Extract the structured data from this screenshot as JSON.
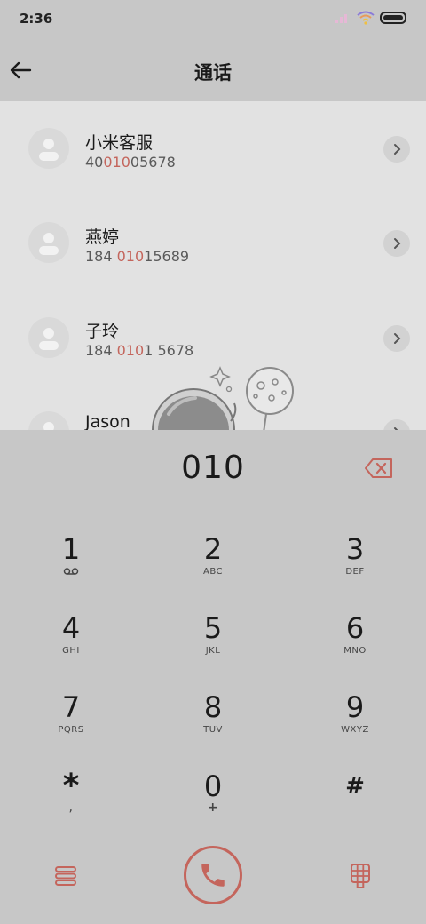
{
  "status": {
    "time": "2:36"
  },
  "header": {
    "title": "通话"
  },
  "contacts": [
    {
      "name": "小米客服",
      "num_pre": "40",
      "num_hl": "010",
      "num_post": "05678"
    },
    {
      "name": "燕婷",
      "num_pre": "184 ",
      "num_hl": "010",
      "num_post": "15689"
    },
    {
      "name": "子玲",
      "num_pre": "184 ",
      "num_hl": "010",
      "num_post": "1 5678"
    },
    {
      "name": "Jason",
      "num_pre": "",
      "num_hl": "",
      "num_post": ""
    }
  ],
  "dialer": {
    "input": "010",
    "keys": [
      {
        "digit": "1",
        "sub": ""
      },
      {
        "digit": "2",
        "sub": "ABC"
      },
      {
        "digit": "3",
        "sub": "DEF"
      },
      {
        "digit": "4",
        "sub": "GHI"
      },
      {
        "digit": "5",
        "sub": "JKL"
      },
      {
        "digit": "6",
        "sub": "MNO"
      },
      {
        "digit": "7",
        "sub": "PQRS"
      },
      {
        "digit": "8",
        "sub": "TUV"
      },
      {
        "digit": "9",
        "sub": "WXYZ"
      },
      {
        "digit": "*",
        "sub": ","
      },
      {
        "digit": "0",
        "sub": "+"
      },
      {
        "digit": "#",
        "sub": ""
      }
    ]
  },
  "colors": {
    "accent": "#c4655c",
    "panel": "#c7c7c7",
    "list": "#e2e2e2"
  },
  "icons": [
    "back-arrow-icon",
    "wifi-icon",
    "battery-icon",
    "person-icon",
    "chevron-right-icon",
    "backspace-icon",
    "voicemail-icon",
    "menu-icon",
    "phone-icon",
    "dialpad-icon"
  ]
}
